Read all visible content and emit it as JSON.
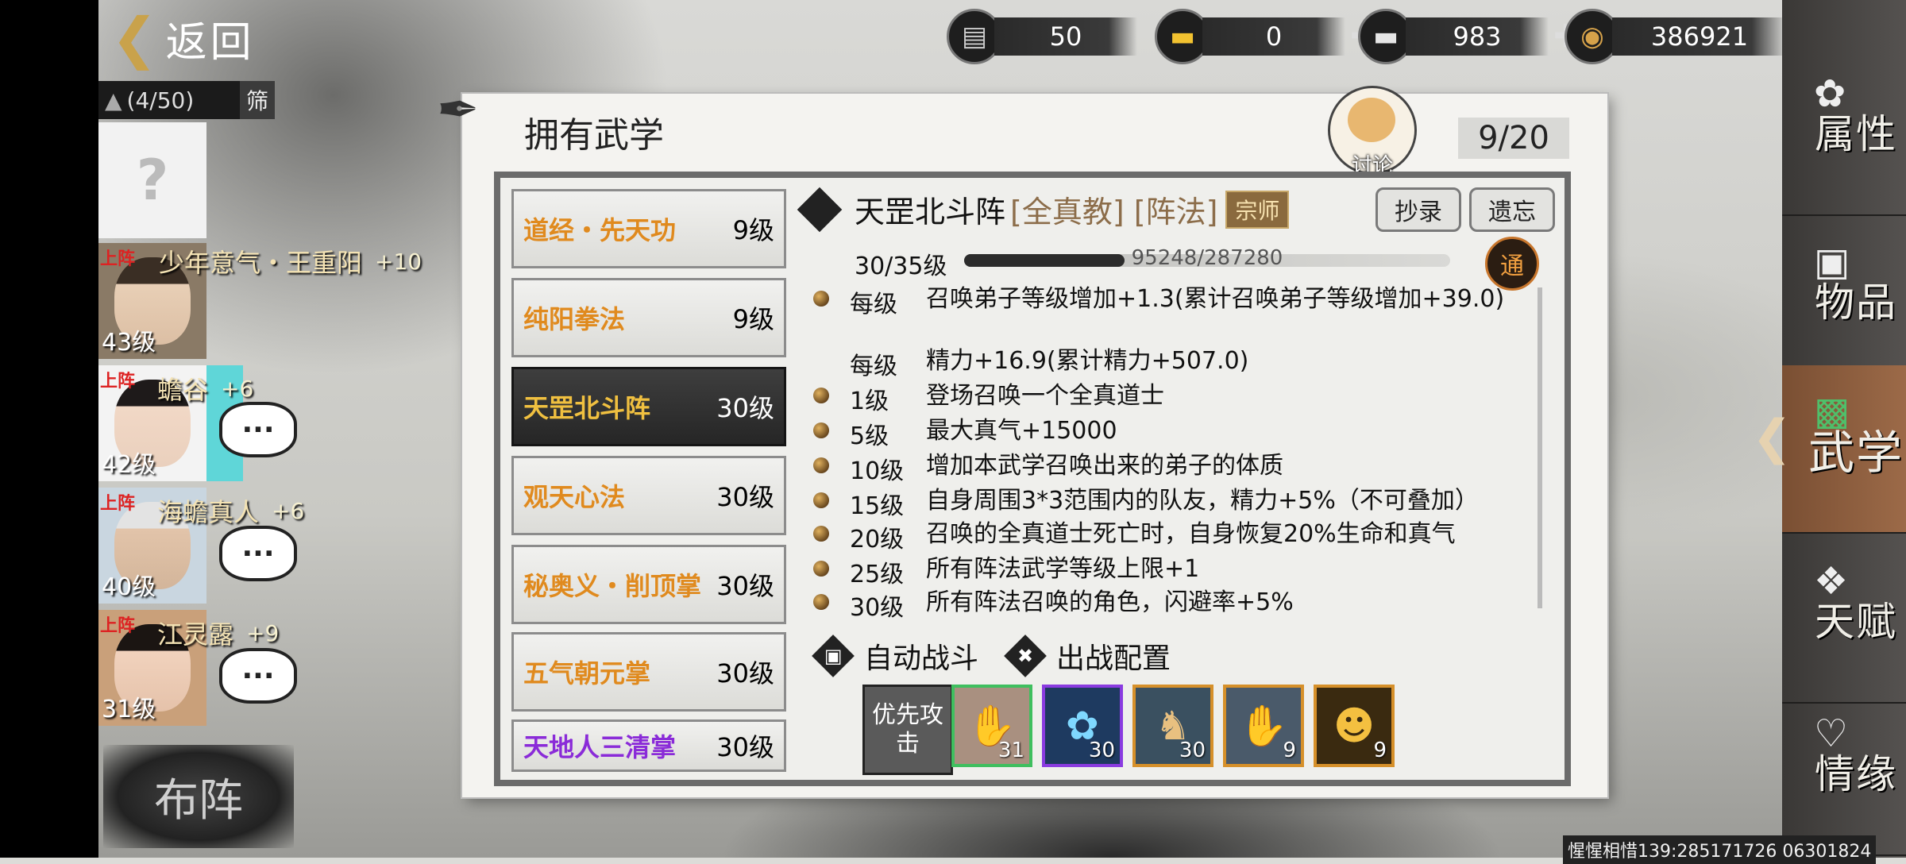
{
  "back": {
    "label": "返回"
  },
  "currencies": [
    {
      "icon": "bench-icon",
      "value": "50"
    },
    {
      "icon": "gold-ingot-icon",
      "value": "0"
    },
    {
      "icon": "silver-ingot-icon",
      "value": "983"
    },
    {
      "icon": "coin-icon",
      "value": "386921"
    }
  ],
  "roster": {
    "count": "(4/50)",
    "filter_label": "筛",
    "empty_slot": "?",
    "heroes": [
      {
        "tag": "上阵",
        "name": "少年意气・王重阳",
        "bonus": "+10",
        "level": "43级"
      },
      {
        "tag": "上阵",
        "name": "蟾谷",
        "bonus": "+6",
        "level": "42级"
      },
      {
        "tag": "上阵",
        "name": "海蟾真人",
        "bonus": "+6",
        "level": "40级"
      },
      {
        "tag": "上阵",
        "name": "江灵露",
        "bonus": "+9",
        "level": "31级"
      }
    ],
    "formation_label": "布阵"
  },
  "panel": {
    "title": "拥有武学",
    "discuss_label": "讨论",
    "page": "9/20"
  },
  "skills": [
    {
      "name": "道经・先天功",
      "level": "9级",
      "color": "#e08a1e"
    },
    {
      "name": "纯阳拳法",
      "level": "9级",
      "color": "#e08a1e"
    },
    {
      "name": "天罡北斗阵",
      "level": "30级",
      "color": "#f0c040"
    },
    {
      "name": "观天心法",
      "level": "30级",
      "color": "#e08a1e"
    },
    {
      "name": "秘奥义・削顶掌",
      "level": "30级",
      "color": "#e08a1e"
    },
    {
      "name": "五气朝元掌",
      "level": "30级",
      "color": "#e08a1e"
    },
    {
      "name": "天地人三清掌",
      "level": "30级",
      "color": "#8a2bd8"
    }
  ],
  "detail": {
    "name": "天罡北斗阵",
    "tags": "[全真教] [阵法]",
    "badge": "宗师",
    "copy_label": "抄录",
    "forget_label": "遗忘",
    "level_text": "30/35级",
    "xp_text": "95248/287280",
    "xp_fraction": 0.33,
    "tong_label": "通",
    "effects": [
      {
        "key": "每级",
        "value": "召唤弟子等级增加+1.3(累计召唤弟子等级增加+39.0)"
      },
      {
        "key": "每级",
        "value": "精力+16.9(累计精力+507.0)"
      },
      {
        "key": "1级",
        "value": "登场召唤一个全真道士"
      },
      {
        "key": "5级",
        "value": "最大真气+15000"
      },
      {
        "key": "10级",
        "value": "增加本武学召唤出来的弟子的体质"
      },
      {
        "key": "15级",
        "value": "自身周围3*3范围内的队友，精力+5%（不可叠加）"
      },
      {
        "key": "20级",
        "value": "召唤的全真道士死亡时，自身恢复20%生命和真气"
      },
      {
        "key": "25级",
        "value": "所有阵法武学等级上限+1"
      },
      {
        "key": "30级",
        "value": "所有阵法召唤的角色，闪避率+5%"
      }
    ],
    "auto_battle_label": "自动战斗",
    "deploy_label": "出战配置",
    "priority_label": "优先攻击",
    "moves": [
      {
        "icon": "claw-icon",
        "count": "31",
        "border": "#3fbf5f"
      },
      {
        "icon": "lotus-burst-icon",
        "count": "30",
        "border": "#8a3be0"
      },
      {
        "icon": "monk-strike-icon",
        "count": "30",
        "border": "#d6902a"
      },
      {
        "icon": "palm-strike-icon",
        "count": "9",
        "border": "#d6902a"
      },
      {
        "icon": "meditation-icon",
        "count": "9",
        "border": "#d6902a"
      }
    ]
  },
  "nav": [
    {
      "label": "属性",
      "icon": "lotus-icon"
    },
    {
      "label": "物品",
      "icon": "gift-box-icon"
    },
    {
      "label": "武学",
      "icon": "scroll-icon"
    },
    {
      "label": "天赋",
      "icon": "branch-icon"
    },
    {
      "label": "情缘",
      "icon": "heart-icon"
    }
  ],
  "footer": "惺惺相惜139:285171726 06301824"
}
